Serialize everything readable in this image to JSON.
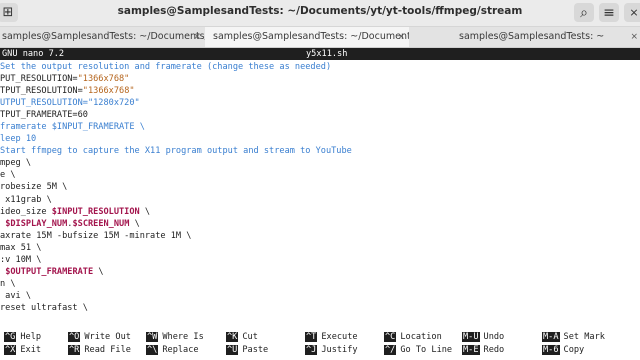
{
  "window": {
    "title": "samples@SamplesandTests: ~/Documents/yt/yt-tools/ffmpeg/stream",
    "new_tab_icon": "⊞",
    "search_icon": "⌕",
    "menu_icon": "≡",
    "close_icon": "⨯"
  },
  "tabs": [
    {
      "label": "samples@SamplesandTests: ~/Documents/…",
      "close": "⨯"
    },
    {
      "label": "samples@SamplesandTests: ~/Documents/…",
      "close": "⨯"
    },
    {
      "label": "samples@SamplesandTests: ~",
      "close": "⨯"
    }
  ],
  "nano": {
    "version": "GNU nano 7.2",
    "filename": "y5x11.sh"
  },
  "lines": [
    {
      "parts": [
        {
          "t": "Set the output resolution and framerate (change these as needed)",
          "c": "comment"
        }
      ]
    },
    {
      "parts": [
        {
          "t": "PUT_RESOLUTION=",
          "c": ""
        },
        {
          "t": "\"1366x768\"",
          "c": "str"
        }
      ]
    },
    {
      "parts": [
        {
          "t": "TPUT_RESOLUTION=",
          "c": ""
        },
        {
          "t": "\"1366x768\"",
          "c": "str"
        }
      ]
    },
    {
      "parts": [
        {
          "t": "UTPUT_RESOLUTION=\"1280x720\"",
          "c": "comment"
        }
      ]
    },
    {
      "parts": [
        {
          "t": "TPUT_FRAMERATE=60",
          "c": ""
        }
      ]
    },
    {
      "parts": [
        {
          "t": "framerate $INPUT_FRAMERATE \\",
          "c": "comment"
        }
      ]
    },
    {
      "parts": [
        {
          "t": "leep 10",
          "c": "comment"
        }
      ]
    },
    {
      "parts": [
        {
          "t": "Start ffmpeg to capture the X11 program output and stream to YouTube",
          "c": "comment"
        }
      ]
    },
    {
      "parts": [
        {
          "t": "mpeg \\",
          "c": ""
        }
      ]
    },
    {
      "parts": [
        {
          "t": "e \\",
          "c": ""
        }
      ]
    },
    {
      "parts": [
        {
          "t": "robesize 5M \\",
          "c": ""
        }
      ]
    },
    {
      "parts": [
        {
          "t": " x11grab \\",
          "c": ""
        }
      ]
    },
    {
      "parts": [
        {
          "t": "ideo_size ",
          "c": ""
        },
        {
          "t": "$INPUT_RESOLUTION",
          "c": "var"
        },
        {
          "t": " \\",
          "c": ""
        }
      ]
    },
    {
      "parts": [
        {
          "t": " ",
          "c": ""
        },
        {
          "t": "$DISPLAY_NUM",
          "c": "var"
        },
        {
          "t": ".",
          "c": ""
        },
        {
          "t": "$SCREEN_NUM",
          "c": "var"
        },
        {
          "t": " \\",
          "c": ""
        }
      ]
    },
    {
      "parts": [
        {
          "t": "axrate 15M -bufsize 15M -minrate 1M \\",
          "c": ""
        }
      ]
    },
    {
      "parts": [
        {
          "t": "max 51 \\",
          "c": ""
        }
      ]
    },
    {
      "parts": [
        {
          "t": ":v 10M \\",
          "c": ""
        }
      ]
    },
    {
      "parts": [
        {
          "t": " ",
          "c": ""
        },
        {
          "t": "$OUTPUT_FRAMERATE",
          "c": "var"
        },
        {
          "t": " \\",
          "c": ""
        }
      ]
    },
    {
      "parts": [
        {
          "t": "n \\",
          "c": ""
        }
      ]
    },
    {
      "parts": [
        {
          "t": " avi \\",
          "c": ""
        }
      ]
    },
    {
      "parts": [
        {
          "t": "reset ultrafast \\",
          "c": ""
        }
      ]
    }
  ],
  "shortcuts": [
    [
      {
        "key": "^G",
        "label": "Help"
      },
      {
        "key": "^O",
        "label": "Write Out"
      },
      {
        "key": "^W",
        "label": "Where Is"
      },
      {
        "key": "^K",
        "label": "Cut"
      },
      {
        "key": "^T",
        "label": "Execute"
      },
      {
        "key": "^C",
        "label": "Location"
      },
      {
        "key": "M-U",
        "label": "Undo"
      },
      {
        "key": "M-A",
        "label": "Set Mark"
      }
    ],
    [
      {
        "key": "^X",
        "label": "Exit"
      },
      {
        "key": "^R",
        "label": "Read File"
      },
      {
        "key": "^\\",
        "label": "Replace"
      },
      {
        "key": "^U",
        "label": "Paste"
      },
      {
        "key": "^J",
        "label": "Justify"
      },
      {
        "key": "^/",
        "label": "Go To Line"
      },
      {
        "key": "M-E",
        "label": "Redo"
      },
      {
        "key": "M-6",
        "label": "Copy"
      }
    ]
  ]
}
